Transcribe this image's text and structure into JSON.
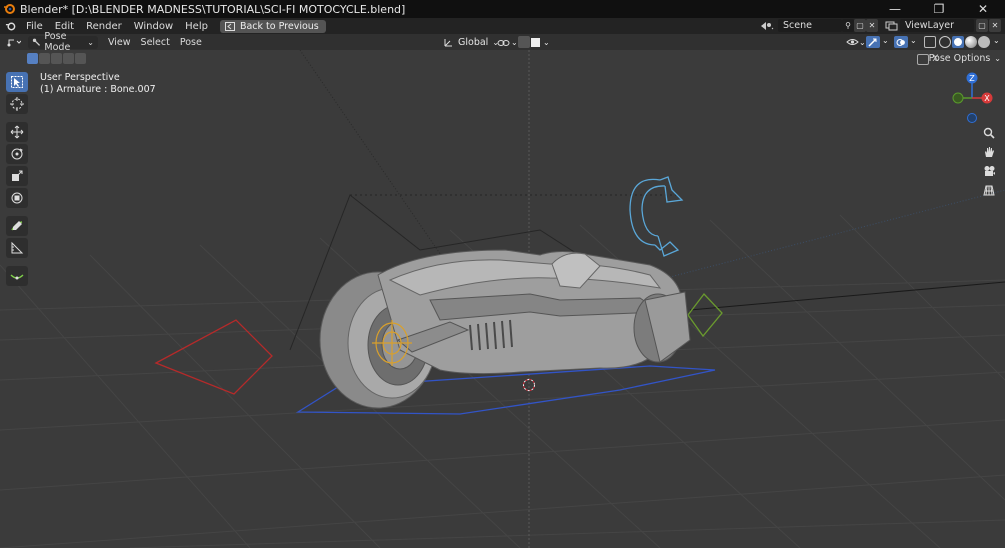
{
  "window": {
    "title": "Blender* [D:\\BLENDER MADNESS\\TUTORIAL\\SCI-FI MOTOCYCLE.blend]",
    "minimize_glyph": "—",
    "maximize_glyph": "❐",
    "close_glyph": "✕"
  },
  "menu": {
    "items": [
      "File",
      "Edit",
      "Render",
      "Window",
      "Help"
    ],
    "back_label": "Back to Previous",
    "scene_label": "Scene",
    "viewlayer_label": "ViewLayer"
  },
  "header": {
    "mode_label": "Pose Mode",
    "view_label": "View",
    "select_label": "Select",
    "pose_label": "Pose",
    "transform_orientation": "Global"
  },
  "viewport": {
    "perspective_label": "User Perspective",
    "active_object_label": "(1) Armature : Bone.007",
    "pose_options_label": "Pose Options"
  },
  "gizmo": {
    "axis_z": "Z",
    "axis_x": "X",
    "z_color": "#2f6fd6",
    "x_color": "#d73a3a",
    "y_color": "#5a9a2c"
  },
  "colors": {
    "active_tool": "#4772b3",
    "grid": "#444444",
    "bone_red": "#b52a2a",
    "bone_blue": "#3254c7",
    "bone_green": "#6a9a2e",
    "rotate_gizmo": "#5aa7d8"
  }
}
